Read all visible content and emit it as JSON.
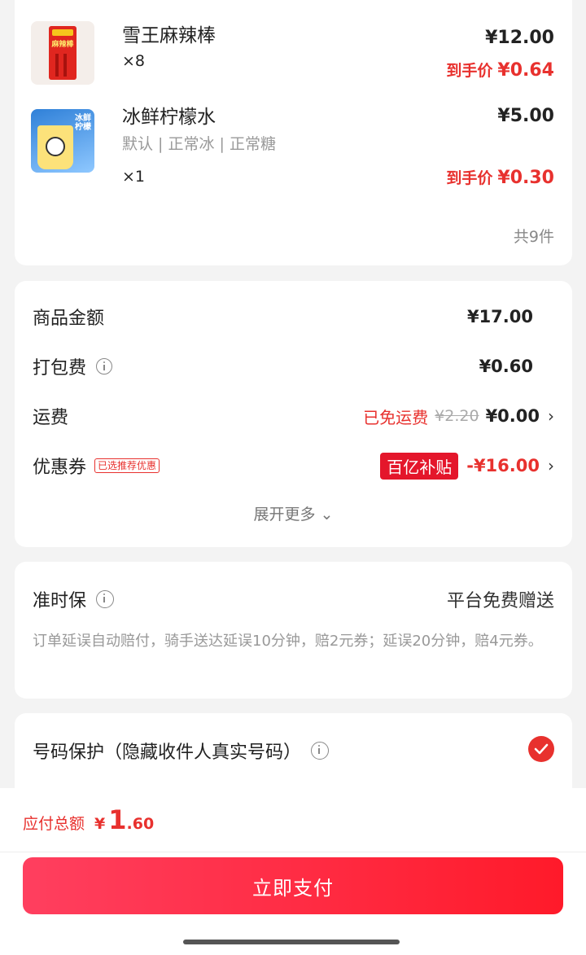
{
  "items": [
    {
      "name": "雪王麻辣棒",
      "spec": "",
      "qty": "×8",
      "price": "¥12.00",
      "final_label": "到手价",
      "final_price": "¥0.64",
      "thumb_text": "麻辣棒"
    },
    {
      "name": "冰鲜柠檬水",
      "spec": "默认 | 正常冰 | 正常糖",
      "qty": "×1",
      "price": "¥5.00",
      "final_label": "到手价",
      "final_price": "¥0.30",
      "thumb_text": "冰鲜柠檬"
    }
  ],
  "total_count": "共9件",
  "fees": {
    "goods_label": "商品金额",
    "goods_amount": "¥17.00",
    "packing_label": "打包费",
    "packing_amount": "¥0.60",
    "shipping_label": "运费",
    "shipping_free": "已免运费",
    "shipping_original": "¥2.20",
    "shipping_amount": "¥0.00",
    "coupon_label": "优惠券",
    "coupon_tag": "已选推荐优惠",
    "coupon_badge": "百亿补贴",
    "coupon_amount": "-¥16.00",
    "expand": "展开更多 ⌄"
  },
  "guarantee": {
    "title": "准时保",
    "right": "平台免费赠送",
    "desc": "订单延误自动赔付，骑手送达延误10分钟，赔2元券；延误20分钟，赔4元券。"
  },
  "privacy": {
    "label": "号码保护（隐藏收件人真实号码）",
    "checked": true
  },
  "footer": {
    "total_label": "应付总额",
    "currency": "¥",
    "total_int": "1",
    "total_dec": ".60",
    "pay_button": "立即支付"
  },
  "colors": {
    "accent": "#e8312e",
    "badge": "#e4162b"
  }
}
